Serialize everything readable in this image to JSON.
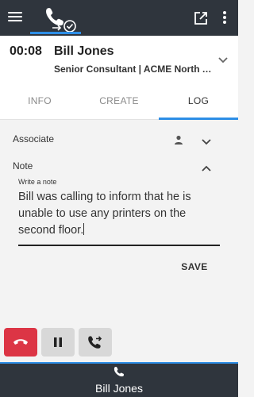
{
  "topbar": {
    "menu_icon": "hamburger-menu-icon",
    "active_icon": "phone-check-icon",
    "popout_icon": "open-external-icon",
    "more_icon": "more-vertical-icon"
  },
  "call": {
    "timer": "00:08",
    "caller_name": "Bill Jones",
    "caller_title": "Senior Consultant | ACME North America"
  },
  "tabs": [
    {
      "label": "INFO",
      "active": false
    },
    {
      "label": "CREATE",
      "active": false
    },
    {
      "label": "LOG",
      "active": true
    }
  ],
  "log": {
    "associate_label": "Associate",
    "note_label": "Note",
    "note_caption": "Write a note",
    "note_text": "Bill was calling to inform that he is unable to use any printers on the second floor.",
    "save_label": "SAVE"
  },
  "actions": [
    {
      "name": "hang-up",
      "icon": "phone-hangup-icon"
    },
    {
      "name": "hold",
      "icon": "pause-icon"
    },
    {
      "name": "transfer",
      "icon": "phone-forward-icon"
    }
  ],
  "footer": {
    "name": "Bill Jones",
    "icon": "phone-icon"
  },
  "colors": {
    "bar": "#2f353d",
    "accent": "#2d8ee6",
    "hangup": "#dc3545"
  }
}
